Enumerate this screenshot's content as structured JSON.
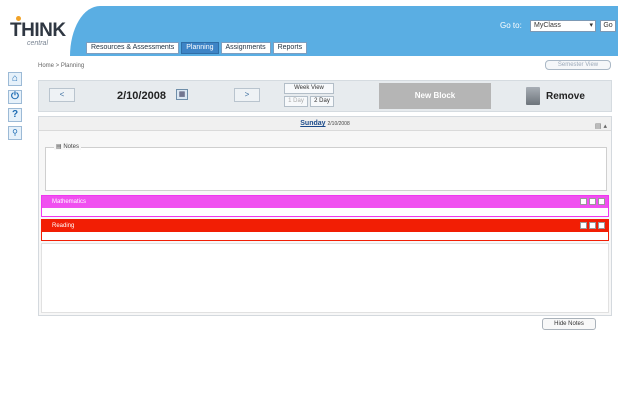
{
  "brand": {
    "logo_text": "THINK",
    "logo_sub": "central",
    "accent": "#5aaee3",
    "logo_dot": "#f1a227"
  },
  "goto": {
    "label": "Go to:",
    "selected": "MyClass",
    "go_label": "Go"
  },
  "tabs": [
    {
      "label": "Resources & Assessments",
      "active": false
    },
    {
      "label": "Planning",
      "active": true
    },
    {
      "label": "Assignments",
      "active": false
    },
    {
      "label": "Reports",
      "active": false
    }
  ],
  "breadcrumb": "Home > Planning",
  "semester_button": "Semester View",
  "sidebar": {
    "icons": [
      "home-icon",
      "power-icon",
      "help-icon",
      "search-icon"
    ],
    "glyphs": [
      "⌂",
      "⏻",
      "?",
      "🔍"
    ]
  },
  "toolbar": {
    "prev_label": "<",
    "next_label": ">",
    "date": "2/10/2008",
    "week_view": "Week View",
    "one_day": "1 Day",
    "two_day": "2 Day",
    "new_block": "New Block",
    "remove": "Remove"
  },
  "day": {
    "name": "Sunday",
    "date": "2/10/2008",
    "notes_label": "Notes"
  },
  "blocks": [
    {
      "label": "Mathematics",
      "color": "#f050f0"
    },
    {
      "label": "Reading",
      "color": "#f21e04"
    }
  ],
  "hide_notes": "Hide Notes"
}
